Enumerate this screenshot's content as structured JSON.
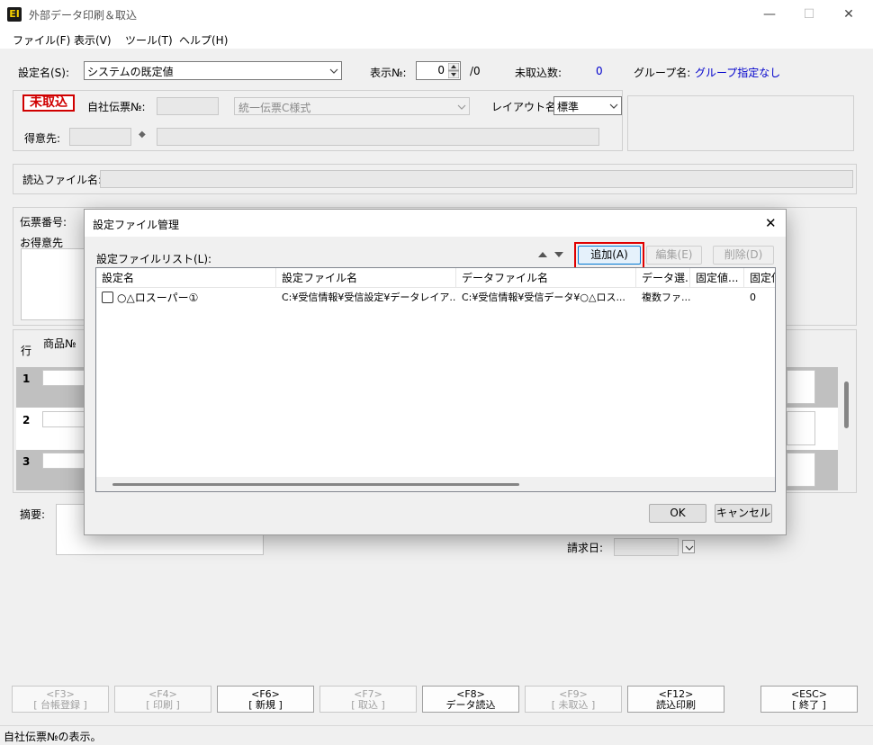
{
  "window": {
    "title": "外部データ印刷＆取込",
    "icon_text": "EI",
    "minimize": "—",
    "maximize": "☐",
    "close": "✕"
  },
  "menu": [
    "ファイル(F)",
    "表示(V)",
    "ツール(T)",
    "ヘルプ(H)"
  ],
  "top": {
    "settings_label": "設定名(S):",
    "settings_value": "システムの既定値",
    "display_no_label": "表示№:",
    "display_no_value": "0",
    "display_no_total": "/0",
    "unimported_label": "未取込数:",
    "unimported_value": "0",
    "group_label": "グループ名:",
    "group_value": "グループ指定なし"
  },
  "header": {
    "status_badge": "未取込",
    "slip_no_label": "自社伝票№:",
    "slip_format": "統一伝票C様式",
    "layout_label": "レイアウト名:",
    "layout_value": "標準",
    "customer_label": "得意先:",
    "customer_icon": "◆"
  },
  "file": {
    "read_file_label": "読込ファイル名:"
  },
  "detail": {
    "slip_number_label": "伝票番号:",
    "customer_label": "お得意先"
  },
  "grid": {
    "row_label": "行",
    "product_no_label": "商品№",
    "rows": [
      "1",
      "2",
      "3"
    ]
  },
  "summary": {
    "memo_label": "摘要:",
    "bill_date_label": "請求日:"
  },
  "fkeys": [
    {
      "key": "<F3>",
      "label": "[ 台帳登録 ]",
      "enabled": false
    },
    {
      "key": "<F4>",
      "label": "[ 印刷 ]",
      "enabled": false
    },
    {
      "key": "<F6>",
      "label": "[ 新規 ]",
      "enabled": true
    },
    {
      "key": "<F7>",
      "label": "[ 取込 ]",
      "enabled": false
    },
    {
      "key": "<F8>",
      "label": "データ読込",
      "enabled": true
    },
    {
      "key": "<F9>",
      "label": "[ 未取込 ]",
      "enabled": false
    },
    {
      "key": "<F12>",
      "label": "読込印刷",
      "enabled": true
    },
    {
      "key": "<ESC>",
      "label": "[ 終了 ]",
      "enabled": true
    }
  ],
  "status_text": "自社伝票№の表示。",
  "dialog": {
    "title": "設定ファイル管理",
    "close": "✕",
    "list_label": "設定ファイルリスト(L):",
    "add_button": "追加(A)",
    "edit_button": "編集(E)",
    "delete_button": "削除(D)",
    "ok_button": "OK",
    "cancel_button": "キャンセル",
    "columns": [
      "設定名",
      "設定ファイル名",
      "データファイル名",
      "データ選...",
      "固定値...",
      "固定値"
    ],
    "rows": [
      {
        "name": "○△ロスーパー①",
        "settings_file": "C:¥受信情報¥受信設定¥データレイア...",
        "data_file": "C:¥受信情報¥受信データ¥○△ロス...",
        "data_select": "複数ファ...",
        "fixed1": "",
        "fixed2": "0"
      }
    ]
  }
}
